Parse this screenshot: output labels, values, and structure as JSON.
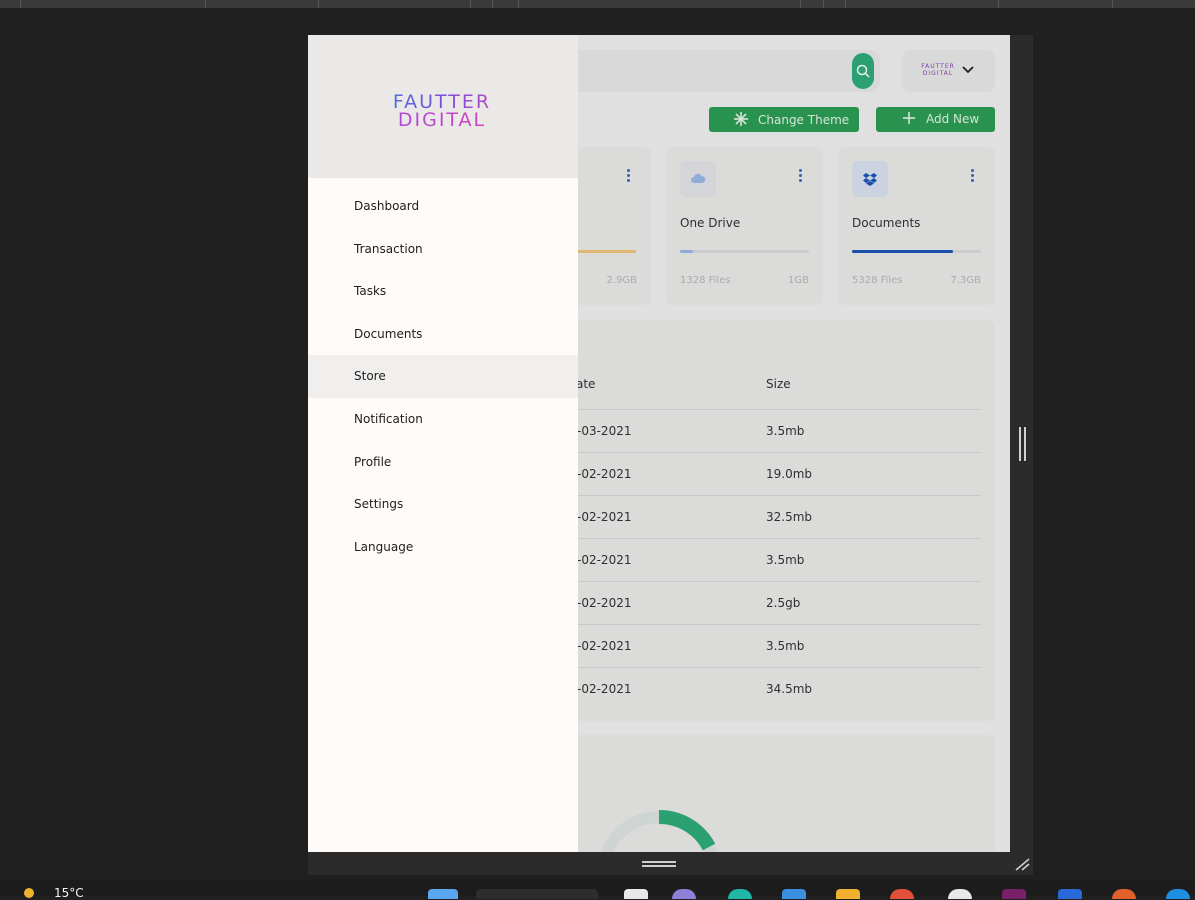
{
  "header": {
    "search_placeholder": ""
  },
  "profile": {
    "logo_line1": "FAUTTER",
    "logo_line2": "DIGITAL"
  },
  "toolbar": {
    "change_theme_label": "Change Theme",
    "add_new_label": "Add New"
  },
  "cards": [
    {
      "title": "",
      "files": "",
      "size": "2.9GB",
      "progress": 1.0,
      "color": "#f1c67c"
    },
    {
      "title": "One Drive",
      "files": "1328 Files",
      "size": "1GB",
      "progress": 0.1,
      "color": "#9db8ea"
    },
    {
      "title": "Documents",
      "files": "5328 Files",
      "size": "7.3GB",
      "progress": 0.78,
      "color": "#1a56b8"
    }
  ],
  "table": {
    "columns": [
      "ate",
      "Size"
    ],
    "rows": [
      {
        "date": "-03-2021",
        "size": "3.5mb"
      },
      {
        "date": "-02-2021",
        "size": "19.0mb"
      },
      {
        "date": "-02-2021",
        "size": "32.5mb"
      },
      {
        "date": "-02-2021",
        "size": "3.5mb"
      },
      {
        "date": "-02-2021",
        "size": "2.5gb"
      },
      {
        "date": "-02-2021",
        "size": "3.5mb"
      },
      {
        "date": "-02-2021",
        "size": "34.5mb"
      }
    ]
  },
  "drawer": {
    "logo_line1": "FAUTTER",
    "logo_line2": "DIGITAL",
    "items": [
      {
        "label": "Dashboard",
        "icon": "dashboard-icon",
        "active": false
      },
      {
        "label": "Transaction",
        "icon": "transaction-icon",
        "active": false
      },
      {
        "label": "Tasks",
        "icon": "tasks-icon",
        "active": false
      },
      {
        "label": "Documents",
        "icon": "documents-icon",
        "active": false
      },
      {
        "label": "Store",
        "icon": "store-icon",
        "active": true
      },
      {
        "label": "Notification",
        "icon": "notification-icon",
        "active": false
      },
      {
        "label": "Profile",
        "icon": "profile-icon",
        "active": false
      },
      {
        "label": "Settings",
        "icon": "settings-icon",
        "active": false
      },
      {
        "label": "Language",
        "icon": "language-icon",
        "active": false
      }
    ]
  },
  "taskbar": {
    "temperature": "15°C"
  },
  "colors": {
    "accent": "#2e9e55",
    "search_button": "#2fae7a",
    "drawer_bg": "#fffbf9",
    "donut": "#2fae7a"
  }
}
